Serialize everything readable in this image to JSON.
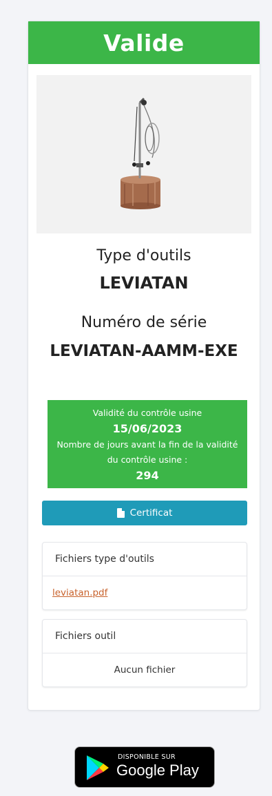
{
  "status": {
    "label": "Valide",
    "color": "#3cb648"
  },
  "tool": {
    "type_label": "Type d'outils",
    "type_value": "LEVIATAN",
    "serial_label": "Numéro de série",
    "serial_value": "LEVIATAN-AAMM-EXE"
  },
  "validity": {
    "title": "Validité du contrôle usine",
    "date": "15/06/2023",
    "days_label": "Nombre de jours avant la fin de la validité du contrôle usine :",
    "days": "294"
  },
  "certificate": {
    "label": "Certificat",
    "icon": "pdf-icon"
  },
  "tool_type_files": {
    "title": "Fichiers type d'outils",
    "files": [
      "leviatan.pdf"
    ]
  },
  "tool_files": {
    "title": "Fichiers outil",
    "empty": "Aucun fichier"
  },
  "store_badge": {
    "small": "DISPONIBLE SUR",
    "big": "Google Play"
  }
}
